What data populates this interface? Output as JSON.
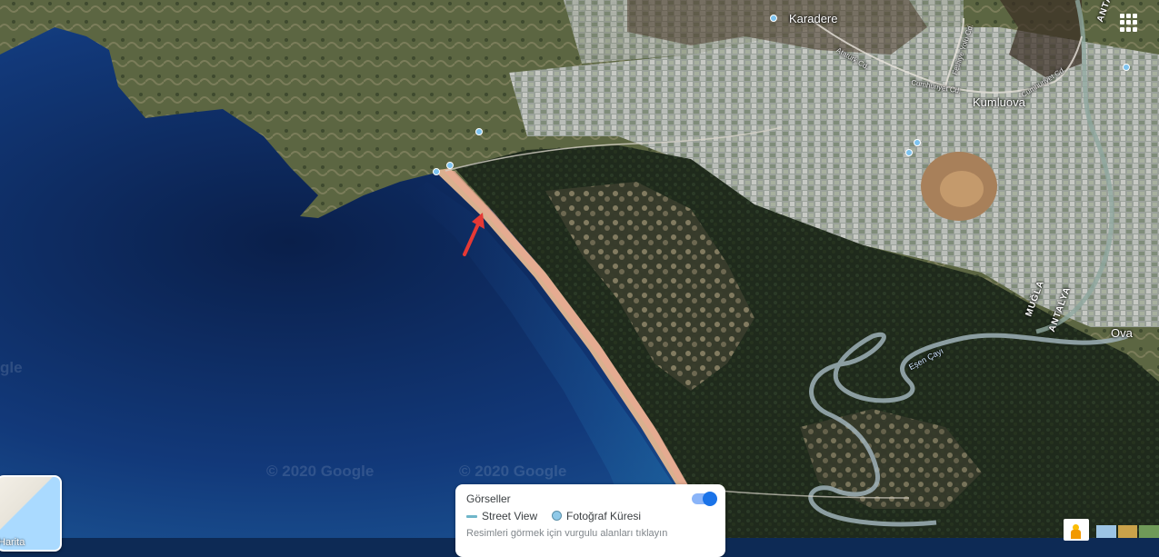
{
  "map": {
    "places": {
      "karadere": "Karadere",
      "kumluova": "Kumluova",
      "ova": "Ova"
    },
    "roads": {
      "ataturk": "Atatürk Cd.",
      "fethiye_yolu": "Fethiye Yolu Cd.",
      "cumhuriyet_1": "Cumhuriyet Cd.",
      "cumhuriyet_2": "Cumhuriyet Cd."
    },
    "provinces": {
      "mugla": "MUĞLA",
      "antalya": "ANTALYA",
      "antalya_top": "ANTA"
    },
    "river": "Eşen Çayı",
    "watermarks": {
      "left": "gle",
      "mid1": "© 2020 Google",
      "mid2": "© 2020 Google"
    }
  },
  "layer_switch": {
    "label": "Harita"
  },
  "legend": {
    "title": "Görseller",
    "street_view": "Street View",
    "photo_sphere": "Fotoğraf Küresi",
    "hint": "Resimleri görmek için vurgulu alanları tıklayın",
    "toggle_on": true
  },
  "colors": {
    "sea": "#123c78",
    "annotation_arrow": "#e53935",
    "toggle_accent": "#1a73e8"
  },
  "icons": {
    "apps": "grid-apps-icon",
    "pegman": "pegman-icon",
    "arrow": "red-arrow-icon"
  }
}
